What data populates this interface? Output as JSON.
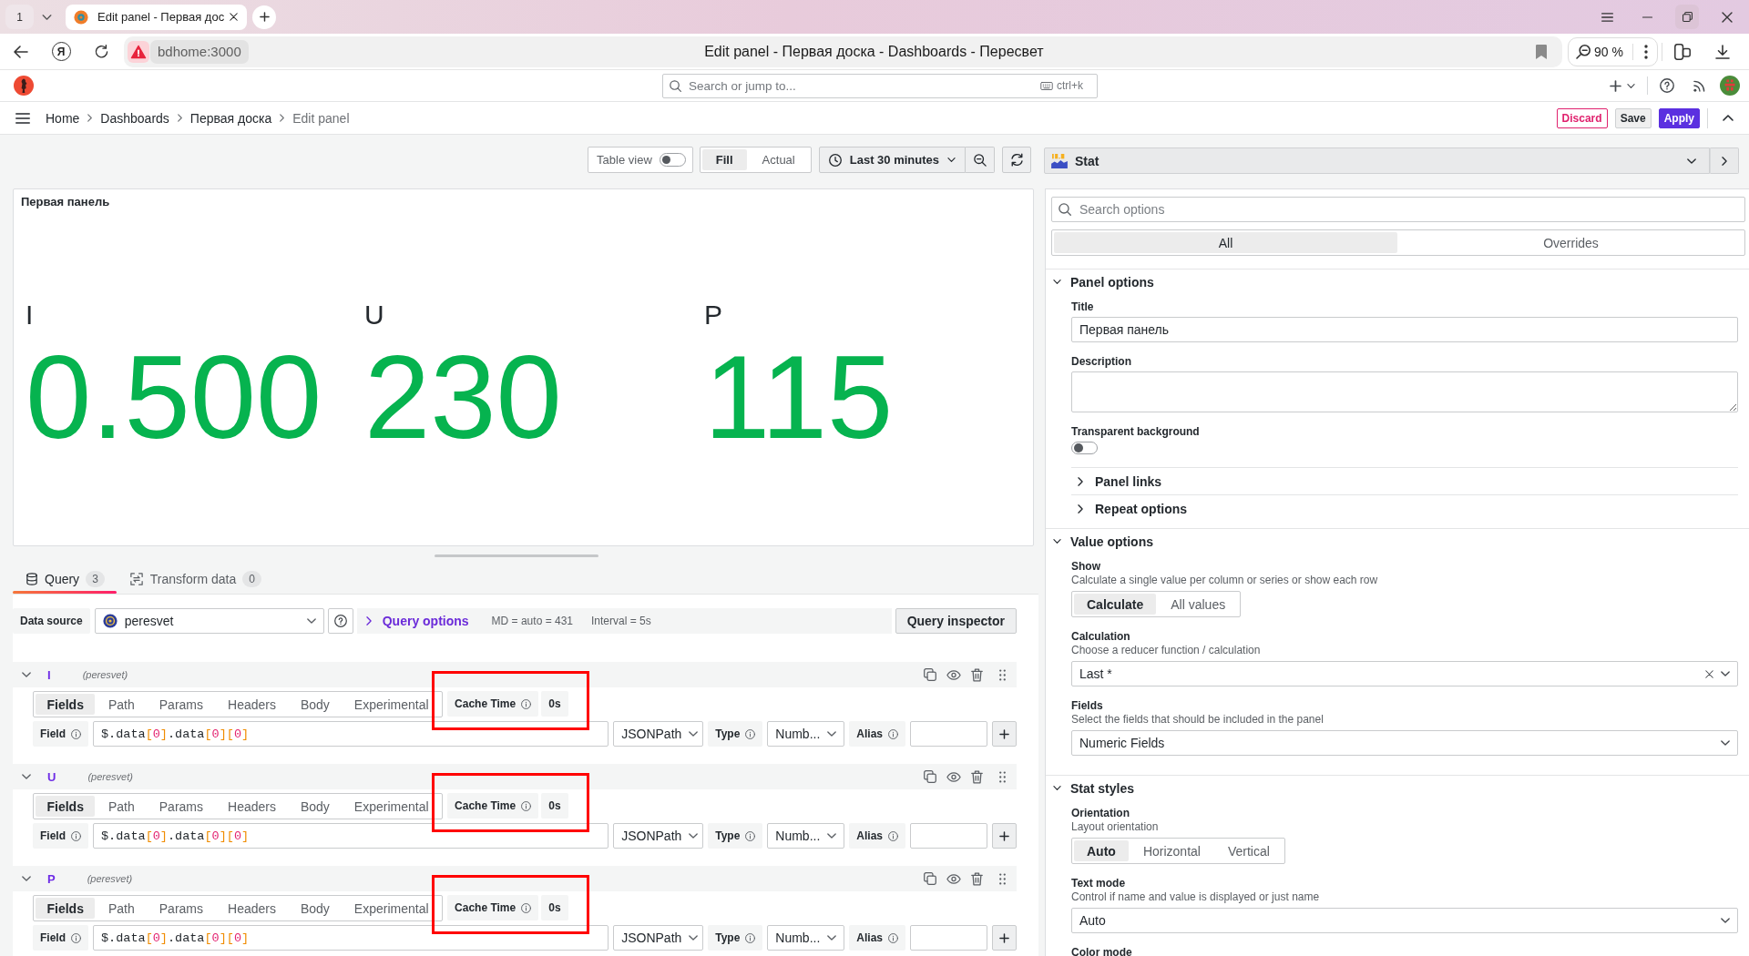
{
  "browser": {
    "tab_counter": "1",
    "tabs": [
      {
        "title": "Edit panel - Первая дос",
        "selected": true
      }
    ],
    "logo_letter": "Я",
    "address": "bdhome:3000",
    "page_title": "Edit panel - Первая доска - Dashboards - Пересвет",
    "zoom": "90 %"
  },
  "topbar": {
    "search_placeholder": "Search or jump to...",
    "shortcut": "ctrl+k"
  },
  "breadcrumbs": [
    "Home",
    "Dashboards",
    "Первая доска",
    "Edit panel"
  ],
  "actions": [
    {
      "label": "Discard",
      "kind": "destructive"
    },
    {
      "label": "Save",
      "kind": "secondary"
    },
    {
      "label": "Apply",
      "kind": "primary"
    }
  ],
  "toolbar": {
    "table_view": {
      "label": "Table view",
      "on": false
    },
    "size_modes": [
      {
        "label": "Fill",
        "selected": true
      },
      {
        "label": "Actual",
        "selected": false
      }
    ],
    "time_range": "Last 30 minutes"
  },
  "panel": {
    "title": "Первая панель",
    "stats": [
      {
        "name": "I",
        "value": "0.500"
      },
      {
        "name": "U",
        "value": "230"
      },
      {
        "name": "P",
        "value": "115"
      }
    ]
  },
  "editor_tabs": [
    {
      "label": "Query",
      "count": "3",
      "selected": true
    },
    {
      "label": "Transform data",
      "count": "0",
      "selected": false
    }
  ],
  "datasource": {
    "label": "Data source",
    "value": "peresvet"
  },
  "query_options": {
    "label": "Query options",
    "expanded": false,
    "max_data_points": "MD = auto = 431",
    "interval": "Interval = 5s"
  },
  "query_inspector": "Query inspector",
  "queries": [
    {
      "ref": "I",
      "datasource": "(peresvet)",
      "expanded": true,
      "highlighted": true,
      "tabs": [
        {
          "label": "Fields",
          "selected": true
        },
        {
          "label": "Path",
          "selected": false
        },
        {
          "label": "Params",
          "selected": false
        },
        {
          "label": "Headers",
          "selected": false
        },
        {
          "label": "Body",
          "selected": false
        },
        {
          "label": "Experimental",
          "selected": false
        }
      ],
      "cache_label": "Cache Time",
      "cache_value": "0s",
      "field_label": "Field",
      "field_tokens": [
        {
          "text": "$.data",
          "kind": "plain"
        },
        {
          "text": "[",
          "kind": "bracket"
        },
        {
          "text": "0",
          "kind": "number"
        },
        {
          "text": "]",
          "kind": "bracket"
        },
        {
          "text": ".data",
          "kind": "plain"
        },
        {
          "text": "[",
          "kind": "bracket"
        },
        {
          "text": "0",
          "kind": "number"
        },
        {
          "text": "]",
          "kind": "bracket"
        },
        {
          "text": "[",
          "kind": "bracket"
        },
        {
          "text": "0",
          "kind": "number"
        },
        {
          "text": "]",
          "kind": "bracket"
        }
      ],
      "parser": "JSONPath",
      "type_label": "Type",
      "type_value": "Numb...",
      "alias_label": "Alias"
    },
    {
      "ref": "U",
      "datasource": "(peresvet)",
      "expanded": true,
      "highlighted": true,
      "tabs": [
        {
          "label": "Fields",
          "selected": true
        },
        {
          "label": "Path",
          "selected": false
        },
        {
          "label": "Params",
          "selected": false
        },
        {
          "label": "Headers",
          "selected": false
        },
        {
          "label": "Body",
          "selected": false
        },
        {
          "label": "Experimental",
          "selected": false
        }
      ],
      "cache_label": "Cache Time",
      "cache_value": "0s",
      "field_label": "Field",
      "field_tokens": [
        {
          "text": "$.data",
          "kind": "plain"
        },
        {
          "text": "[",
          "kind": "bracket"
        },
        {
          "text": "0",
          "kind": "number"
        },
        {
          "text": "]",
          "kind": "bracket"
        },
        {
          "text": ".data",
          "kind": "plain"
        },
        {
          "text": "[",
          "kind": "bracket"
        },
        {
          "text": "0",
          "kind": "number"
        },
        {
          "text": "]",
          "kind": "bracket"
        },
        {
          "text": "[",
          "kind": "bracket"
        },
        {
          "text": "0",
          "kind": "number"
        },
        {
          "text": "]",
          "kind": "bracket"
        }
      ],
      "parser": "JSONPath",
      "type_label": "Type",
      "type_value": "Numb...",
      "alias_label": "Alias"
    },
    {
      "ref": "P",
      "datasource": "(peresvet)",
      "expanded": true,
      "highlighted": true,
      "tabs": [
        {
          "label": "Fields",
          "selected": true
        },
        {
          "label": "Path",
          "selected": false
        },
        {
          "label": "Params",
          "selected": false
        },
        {
          "label": "Headers",
          "selected": false
        },
        {
          "label": "Body",
          "selected": false
        },
        {
          "label": "Experimental",
          "selected": false
        }
      ],
      "cache_label": "Cache Time",
      "cache_value": "0s",
      "field_label": "Field",
      "field_tokens": [
        {
          "text": "$.data",
          "kind": "plain"
        },
        {
          "text": "[",
          "kind": "bracket"
        },
        {
          "text": "0",
          "kind": "number"
        },
        {
          "text": "]",
          "kind": "bracket"
        },
        {
          "text": ".data",
          "kind": "plain"
        },
        {
          "text": "[",
          "kind": "bracket"
        },
        {
          "text": "0",
          "kind": "number"
        },
        {
          "text": "]",
          "kind": "bracket"
        },
        {
          "text": "[",
          "kind": "bracket"
        },
        {
          "text": "0",
          "kind": "number"
        },
        {
          "text": "]",
          "kind": "bracket"
        }
      ],
      "parser": "JSONPath",
      "type_label": "Type",
      "type_value": "Numb...",
      "alias_label": "Alias"
    }
  ],
  "visualization": {
    "label": "Stat"
  },
  "options": {
    "search_placeholder": "Search options",
    "tabs": [
      {
        "label": "All",
        "selected": true
      },
      {
        "label": "Overrides",
        "selected": false
      }
    ],
    "sections": [
      {
        "title": "Panel options",
        "expanded": true,
        "items": [
          {
            "kind": "input",
            "label": "Title",
            "value": "Первая панель"
          },
          {
            "kind": "textarea",
            "label": "Description"
          },
          {
            "kind": "switch",
            "label": "Transparent background",
            "on": false
          },
          {
            "kind": "subsection",
            "label": "Panel links",
            "expanded": false
          },
          {
            "kind": "subsection",
            "label": "Repeat options",
            "expanded": false
          }
        ]
      },
      {
        "title": "Value options",
        "expanded": true,
        "items": [
          {
            "kind": "radio",
            "label": "Show",
            "description": "Calculate a single value per column or series or show each row",
            "options": [
              {
                "label": "Calculate",
                "selected": true
              },
              {
                "label": "All values",
                "selected": false
              }
            ]
          },
          {
            "kind": "select",
            "label": "Calculation",
            "description": "Choose a reducer function / calculation",
            "value": "Last *",
            "clearable": true
          },
          {
            "kind": "select",
            "label": "Fields",
            "description": "Select the fields that should be included in the panel",
            "value": "Numeric Fields"
          }
        ]
      },
      {
        "title": "Stat styles",
        "expanded": true,
        "items": [
          {
            "kind": "radio",
            "label": "Orientation",
            "description": "Layout orientation",
            "options": [
              {
                "label": "Auto",
                "selected": true
              },
              {
                "label": "Horizontal",
                "selected": false
              },
              {
                "label": "Vertical",
                "selected": false
              }
            ]
          },
          {
            "kind": "select",
            "label": "Text mode",
            "description": "Control if name and value is displayed or just name",
            "value": "Auto"
          },
          {
            "kind": "label",
            "label": "Color mode"
          }
        ]
      }
    ]
  }
}
